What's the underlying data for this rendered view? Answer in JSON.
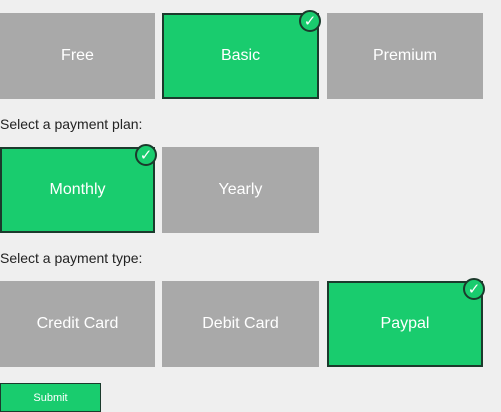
{
  "tiers": {
    "items": [
      {
        "label": "Free",
        "selected": false
      },
      {
        "label": "Basic",
        "selected": true
      },
      {
        "label": "Premium",
        "selected": false
      }
    ]
  },
  "payment_plan": {
    "label": "Select a payment plan:",
    "items": [
      {
        "label": "Monthly",
        "selected": true
      },
      {
        "label": "Yearly",
        "selected": false
      }
    ]
  },
  "payment_type": {
    "label": "Select a payment type:",
    "items": [
      {
        "label": "Credit Card",
        "selected": false
      },
      {
        "label": "Debit Card",
        "selected": false
      },
      {
        "label": "Paypal",
        "selected": true
      }
    ]
  },
  "submit": {
    "label": "Submit"
  },
  "check_glyph": "✓",
  "colors": {
    "selected": "#19cc6e",
    "unselected": "#a9a9a9",
    "border": "#1b3a2c",
    "background": "#efefef"
  }
}
